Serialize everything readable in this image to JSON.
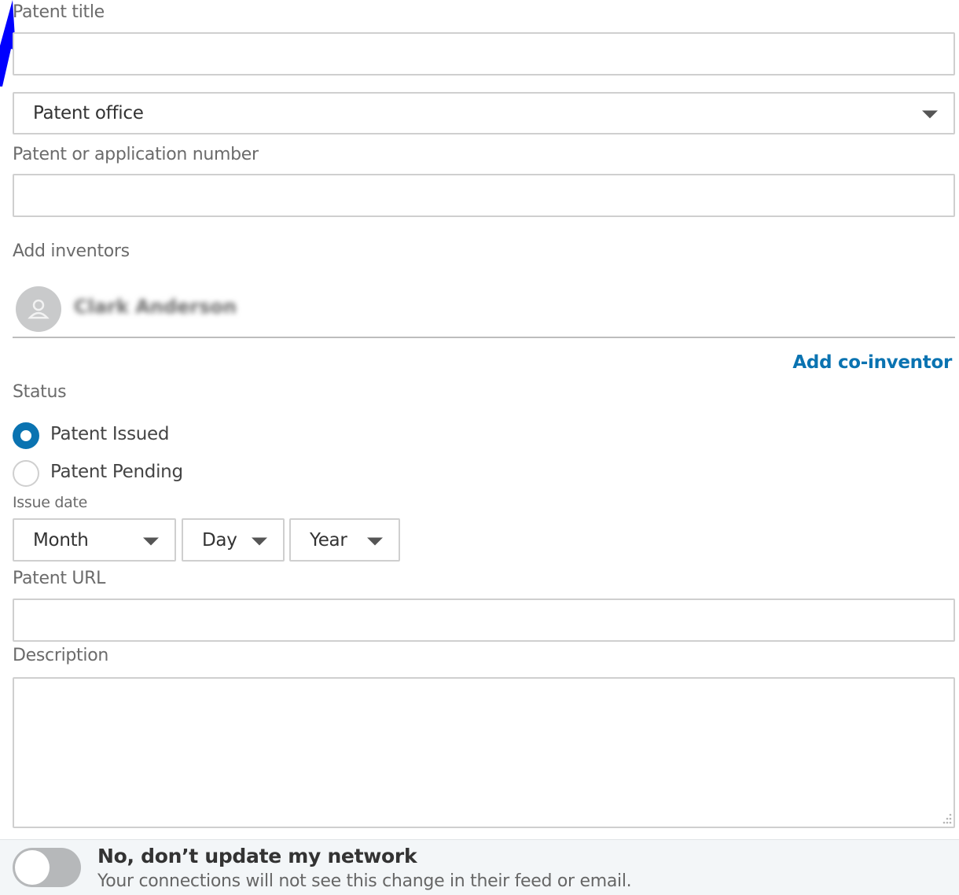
{
  "form": {
    "patent_title_label": "Patent title",
    "patent_title_value": "",
    "patent_office_selected": "Patent office",
    "patent_number_label": "Patent or application number",
    "patent_number_value": "",
    "add_inventors_label": "Add inventors",
    "inventor_name": "Clark Anderson",
    "add_coinventor_link": "Add co-inventor",
    "status_label": "Status",
    "status_options": [
      {
        "label": "Patent Issued",
        "checked": true
      },
      {
        "label": "Patent Pending",
        "checked": false
      }
    ],
    "issue_date_label": "Issue date",
    "issue_date": {
      "month": "Month",
      "day": "Day",
      "year": "Year"
    },
    "patent_url_label": "Patent URL",
    "patent_url_value": "",
    "description_label": "Description",
    "description_value": ""
  },
  "footer": {
    "toggle_on": false,
    "toggle_title": "No, don’t update my network",
    "toggle_subtitle": "Your connections will not see this change in their feed or email."
  },
  "colors": {
    "accent": "#0a73b1",
    "link": "#0a73b1",
    "annotation_arrow": "#0000ff",
    "footer_bg": "#f3f6f8"
  },
  "icons": [
    "dropdown-caret-icon",
    "person-icon",
    "resize-grip-icon",
    "annotation-arrow-icon"
  ]
}
